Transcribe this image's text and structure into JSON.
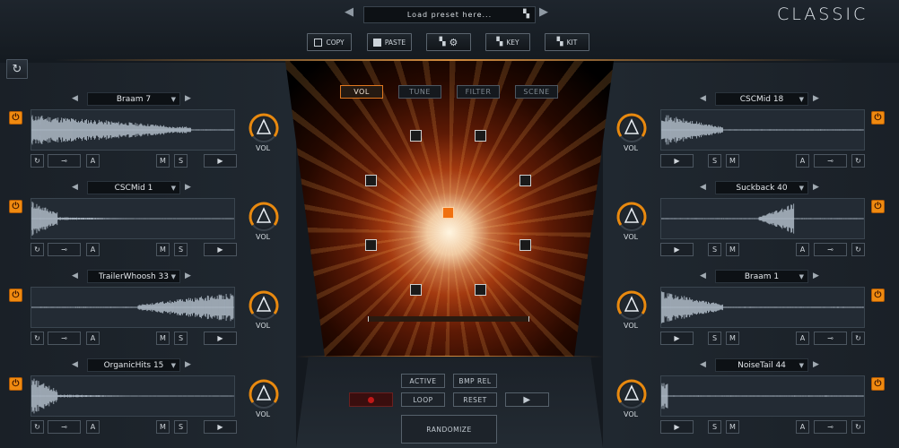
{
  "header": {
    "preset_placeholder": "Load preset here...",
    "brand": "CLASSIC",
    "buttons": {
      "copy": "COPY",
      "paste": "PASTE",
      "key": "KEY",
      "kit": "KIT"
    }
  },
  "center": {
    "tabs": [
      "VOL",
      "TUNE",
      "FILTER",
      "SCENE"
    ],
    "active_tab": "VOL"
  },
  "bottom": {
    "active": "ACTIVE",
    "bmp_rel": "BMP REL",
    "loop": "LOOP",
    "reset": "RESET",
    "randomize": "RANDOMIZE"
  },
  "slot_labels": {
    "vol": "VOL",
    "a": "A",
    "m": "M",
    "s": "S"
  },
  "left_slots": [
    {
      "name": "Braam 7"
    },
    {
      "name": "CSCMid 1"
    },
    {
      "name": "TrailerWhoosh 33"
    },
    {
      "name": "OrganicHits 15"
    }
  ],
  "right_slots": [
    {
      "name": "CSCMid 18"
    },
    {
      "name": "Suckback 40"
    },
    {
      "name": "Braam 1"
    },
    {
      "name": "NoiseTail 44"
    }
  ],
  "colors": {
    "accent": "#f08a10",
    "panel": "#1a2027",
    "waveform": "#b8c4d0"
  },
  "icons": [
    "refresh-icon",
    "power-icon",
    "wrench-icon",
    "play-icon",
    "copy-icon",
    "paste-icon",
    "gear-icon",
    "grid-icon"
  ]
}
